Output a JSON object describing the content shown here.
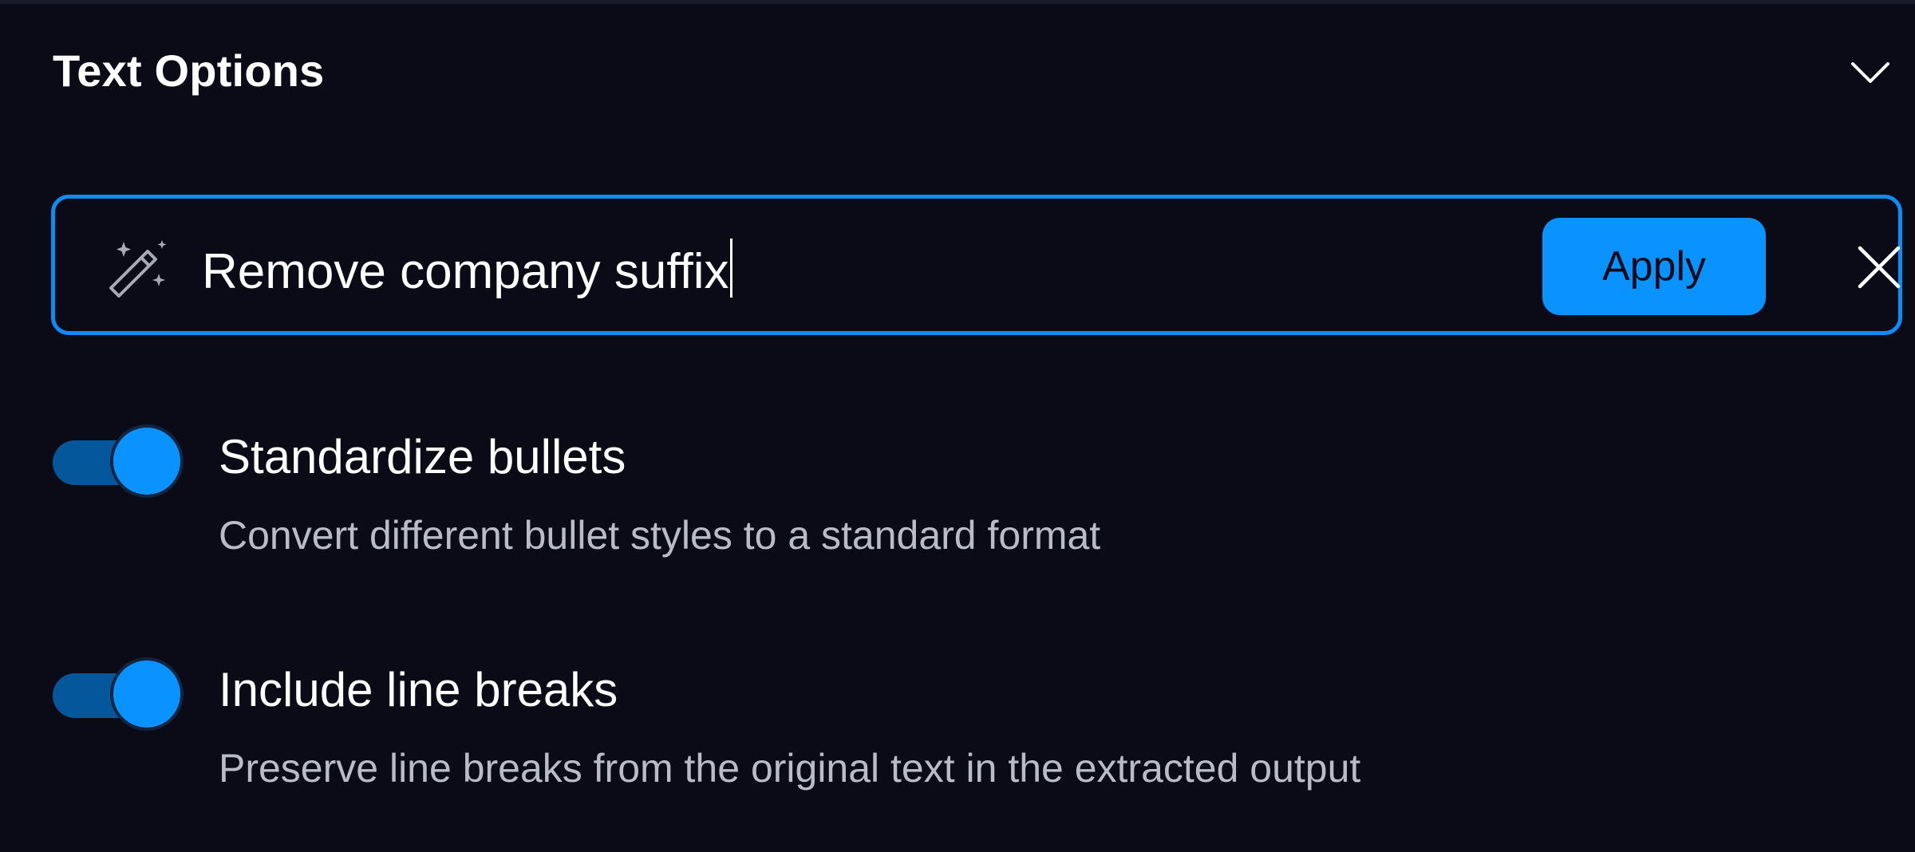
{
  "section": {
    "title": "Text Options",
    "collapse_icon": "chevron-down-icon"
  },
  "prompt": {
    "icon": "magic-wand-icon",
    "value": "Remove company suffix",
    "apply_label": "Apply",
    "close_icon": "close-icon",
    "accent_color": "#0a93ff"
  },
  "options": [
    {
      "label": "Standardize bullets",
      "description": "Convert different bullet styles to a standard format",
      "enabled": true
    },
    {
      "label": "Include line breaks",
      "description": "Preserve line breaks from the original text in the extracted output",
      "enabled": true
    }
  ]
}
